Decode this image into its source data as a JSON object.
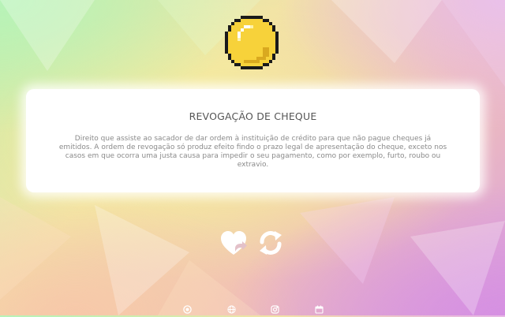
{
  "card": {
    "title": "REVOGAÇÃO DE CHEQUE",
    "body": "Direito que assiste ao sacador de dar ordem à instituição de crédito para que não pague cheques já emitidos. A ordem de revogação só produz efeito findo o prazo legal de apresentação do cheque, exceto nos casos em que ocorra uma justa causa para impedir o seu pagamento, como por exemplo, furto, roubo ou extravio."
  },
  "icons": {
    "coin": "pixel-coin-icon",
    "favorite": "heart-share-icon",
    "refresh": "refresh-icon",
    "footer": [
      "record-icon",
      "globe-icon",
      "instagram-icon",
      "calendar-icon"
    ]
  },
  "colors": {
    "coin_fill": "#f7d23a",
    "coin_outline": "#1a1a1a",
    "card_bg": "#ffffff",
    "title_text": "#555555",
    "body_text": "#8a8a8a",
    "icon_white": "#ffffff"
  }
}
